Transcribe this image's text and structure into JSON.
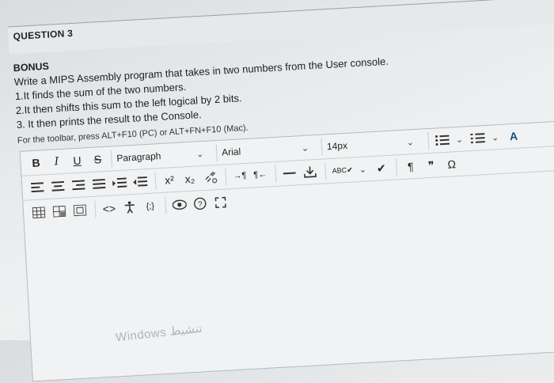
{
  "question": {
    "title": "QUESTION 3",
    "lines": [
      "BONUS",
      "Write a MIPS Assembly program that takes in two numbers from the User console.",
      "1.It finds the sum of the two numbers.",
      "2.It then shifts this sum to the left logical by 2 bits.",
      "3. It then prints the result to the Console."
    ],
    "hint": "For the toolbar, press ALT+F10 (PC) or ALT+FN+F10 (Mac)."
  },
  "toolbar": {
    "bold": "B",
    "italic": "I",
    "underline": "U",
    "strike": "S",
    "paragraph": "Paragraph",
    "font": "Arial",
    "size": "14px",
    "superscript": "x²",
    "subscript": "x₂",
    "code": "<>",
    "media": "{;}",
    "special_char": "Ω",
    "pilcrow": "¶",
    "quote": "❞"
  },
  "watermark": "Windows تنشيط"
}
